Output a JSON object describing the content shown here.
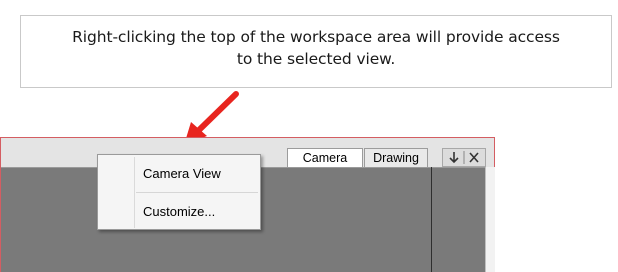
{
  "callout": {
    "line1": "Right-clicking the top of the workspace area will provide access",
    "line2": "to the selected view."
  },
  "tabs": [
    {
      "label": "Camera",
      "active": true
    },
    {
      "label": "Drawing",
      "active": false
    }
  ],
  "tab_icons": [
    "pin-icon",
    "close-icon"
  ],
  "context_menu": {
    "items": [
      {
        "label": "Camera View"
      },
      {
        "label": "Customize..."
      }
    ]
  },
  "colors": {
    "arrow": "#e8251f",
    "frame_border": "#d45d62",
    "workspace": "#7a7a7a"
  }
}
